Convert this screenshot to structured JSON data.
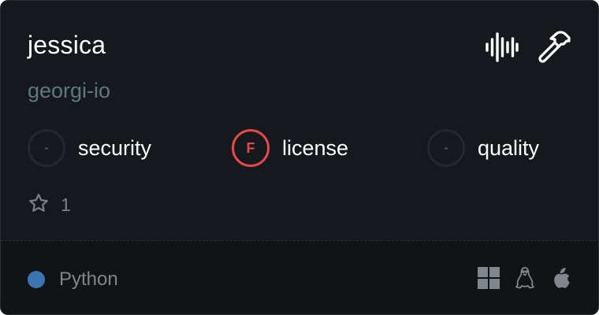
{
  "card": {
    "title": "jessica",
    "owner": "georgi-io",
    "header_icons": [
      "audio-waveform-icon",
      "hammer-icon"
    ]
  },
  "scores": [
    {
      "label": "security",
      "grade": "-"
    },
    {
      "label": "license",
      "grade": "F"
    },
    {
      "label": "quality",
      "grade": "-"
    }
  ],
  "stars": {
    "icon": "star-icon",
    "count": "1"
  },
  "footer": {
    "language": "Python",
    "language_color": "#3b74b3",
    "platforms": [
      "windows-icon",
      "linux-icon",
      "apple-icon"
    ]
  },
  "colors": {
    "background": "#15191d",
    "owner_text": "#5c7a76",
    "grade_fail": "#e5484d"
  }
}
